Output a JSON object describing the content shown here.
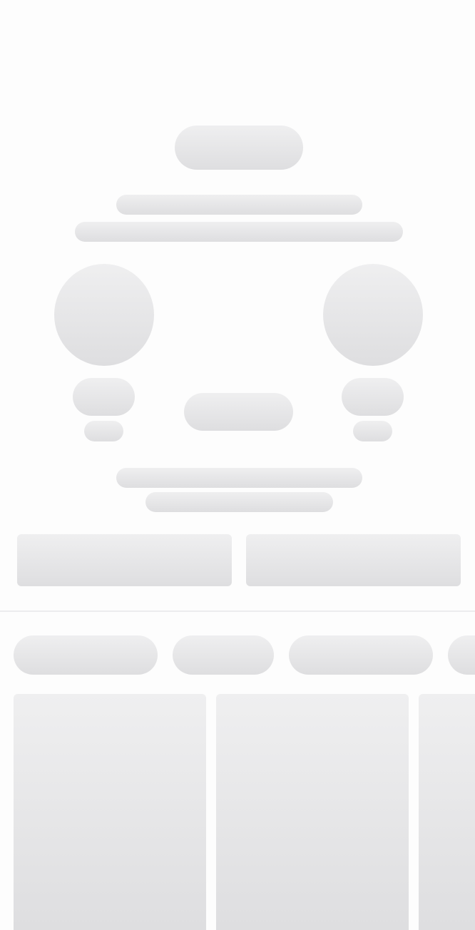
{
  "screen": {
    "state": "loading",
    "background_color": "#fdfdfd",
    "placeholder_gradient": [
      "#efeff0",
      "#dedee0"
    ],
    "divider_color": "#ececee"
  },
  "hero": {
    "badge": "",
    "title": "",
    "subtitle": "",
    "home_team": {
      "logo": "",
      "name": "",
      "score": ""
    },
    "away_team": {
      "logo": "",
      "name": "",
      "score": ""
    },
    "status": "",
    "detail_line_1": "",
    "detail_line_2": ""
  },
  "actions": {
    "primary_label": "",
    "secondary_label": ""
  },
  "tabs": [
    {
      "label": ""
    },
    {
      "label": ""
    },
    {
      "label": ""
    },
    {
      "label": ""
    }
  ],
  "cards": [
    {
      "title": ""
    },
    {
      "title": ""
    },
    {
      "title": ""
    }
  ]
}
